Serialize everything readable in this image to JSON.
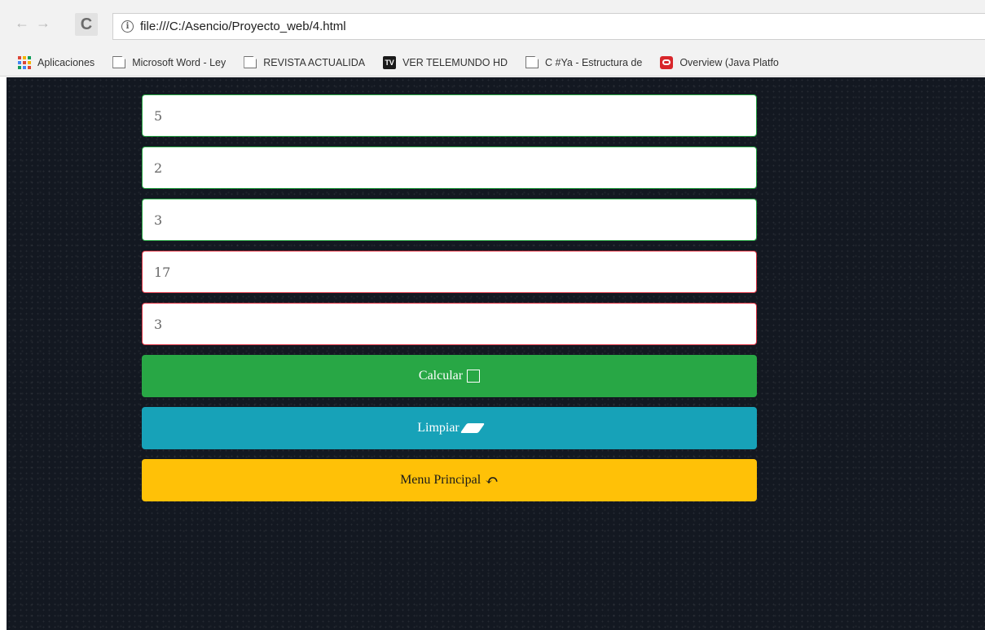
{
  "browser": {
    "url": "file:///C:/Asencio/Proyecto_web/4.html",
    "nav_back_icon": "arrow-left-icon",
    "nav_forward_icon": "arrow-right-icon",
    "reload_icon": "reload-icon"
  },
  "bookmarks": [
    {
      "label": "Aplicaciones",
      "icon": "apps-grid-icon"
    },
    {
      "label": "Microsoft Word - Ley",
      "icon": "page-icon"
    },
    {
      "label": "REVISTA ACTUALIDA",
      "icon": "page-icon"
    },
    {
      "label": "VER TELEMUNDO HD",
      "icon": "tv-icon",
      "icon_text": "TV"
    },
    {
      "label": "C #Ya - Estructura de",
      "icon": "page-icon"
    },
    {
      "label": "Overview (Java Platfo",
      "icon": "oracle-icon"
    }
  ],
  "form": {
    "fields": [
      {
        "value": "5",
        "state": "valid"
      },
      {
        "value": "2",
        "state": "valid"
      },
      {
        "value": "3",
        "state": "valid"
      },
      {
        "value": "17",
        "state": "invalid"
      },
      {
        "value": "3",
        "state": "invalid"
      }
    ],
    "buttons": {
      "calcular": "Calcular",
      "limpiar": "Limpiar",
      "menu": "Menu Principal"
    }
  },
  "colors": {
    "success": "#28a745",
    "info": "#17a2b8",
    "warning": "#ffc107",
    "danger": "#dc3545",
    "background": "#131821"
  }
}
